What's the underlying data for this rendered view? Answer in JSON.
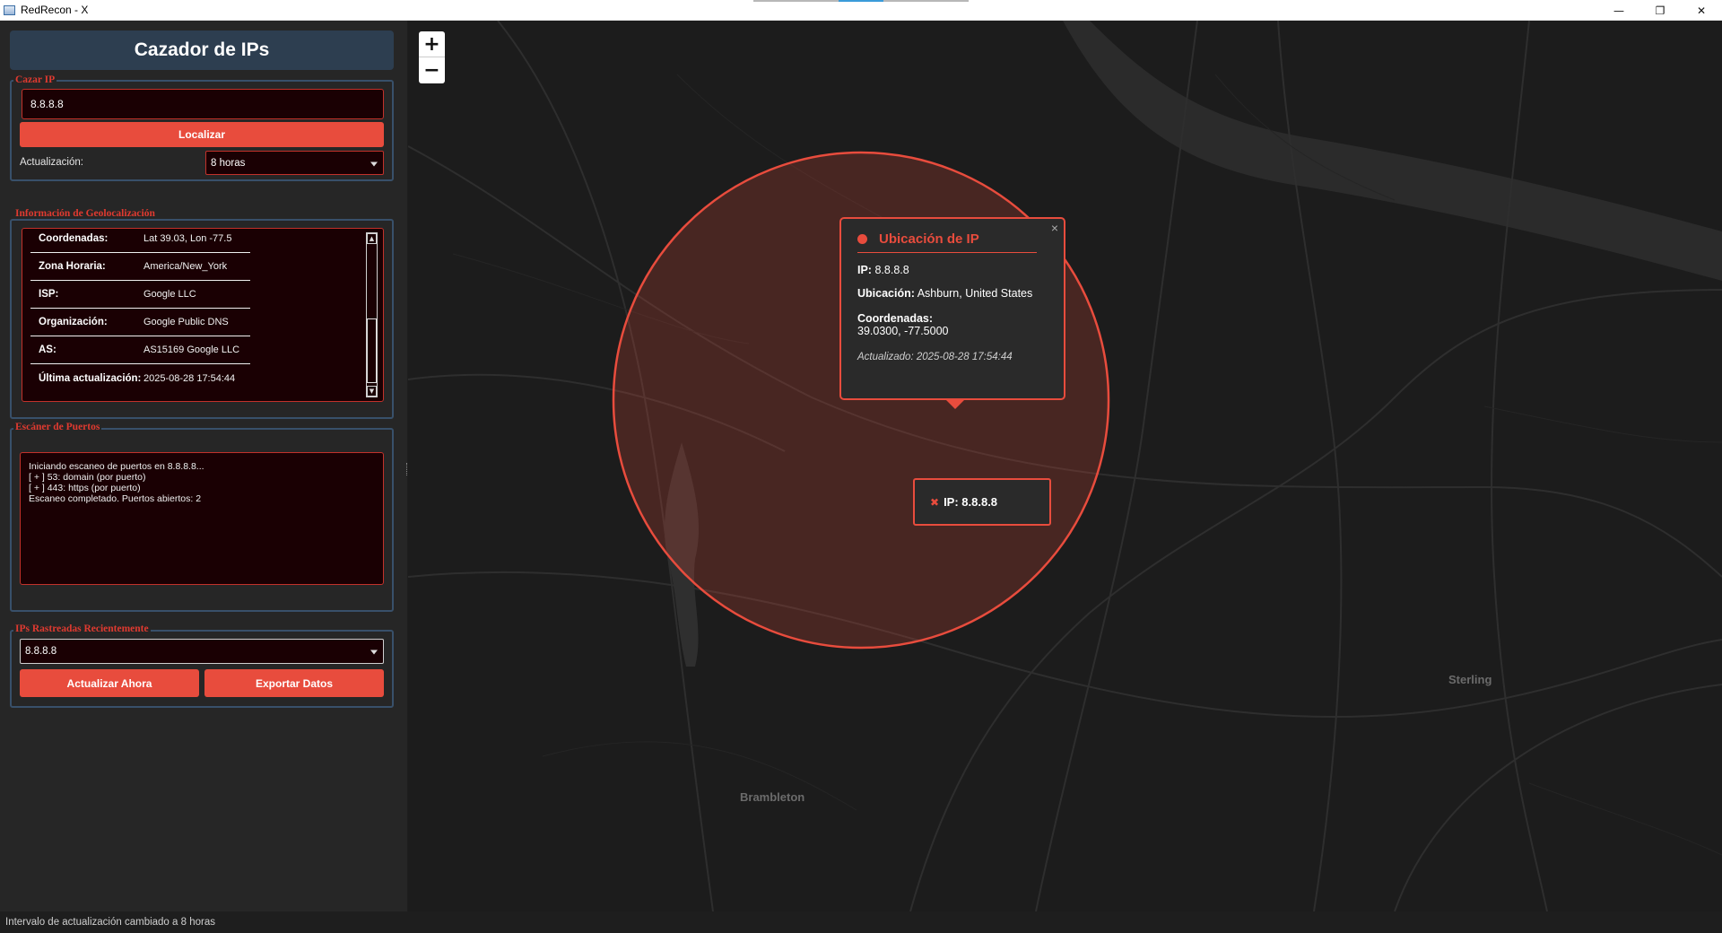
{
  "window": {
    "title": "RedRecon - X",
    "controls": {
      "minimize": "—",
      "restore": "❐",
      "close": "✕"
    }
  },
  "sidebar": {
    "header": "Cazador de IPs",
    "hunt": {
      "label": "Cazar IP",
      "ip_value": "8.8.8.8",
      "locate_button": "Localizar",
      "update_label": "Actualización:",
      "update_value": "8 horas"
    },
    "geo": {
      "label": "Información de Geolocalización",
      "rows": [
        {
          "key": "Coordenadas:",
          "value": "Lat 39.03, Lon -77.5"
        },
        {
          "key": "Zona Horaria:",
          "value": "America/New_York"
        },
        {
          "key": "ISP:",
          "value": "Google LLC"
        },
        {
          "key": "Organización:",
          "value": "Google Public DNS"
        },
        {
          "key": "AS:",
          "value": "AS15169 Google LLC"
        },
        {
          "key": "Última actualización:",
          "value": "2025-08-28 17:54:44"
        }
      ]
    },
    "ports": {
      "label": "Escáner de Puertos",
      "lines": [
        "Iniciando escaneo de puertos en 8.8.8.8...",
        "[ + ] 53: domain (por puerto)",
        "[ + ] 443: https (por puerto)",
        "Escaneo completado. Puertos abiertos: 2"
      ]
    },
    "recent": {
      "label": "IPs Rastreadas Recientemente",
      "selected": "8.8.8.8",
      "refresh_button": "Actualizar Ahora",
      "export_button": "Exportar Datos"
    }
  },
  "map": {
    "zoom_in": "+",
    "zoom_out": "−",
    "places": [
      "Brambleton",
      "Sterling"
    ],
    "popup": {
      "title": "Ubicación de IP",
      "close": "×",
      "ip_label": "IP:",
      "ip_value": "8.8.8.8",
      "location_label": "Ubicación:",
      "location_value": "Ashburn, United States",
      "coords_label": "Coordenadas:",
      "coords_value": "39.0300, -77.5000",
      "updated": "Actualizado: 2025-08-28 17:54:44"
    },
    "marker": {
      "pin": "✖",
      "text": "IP: 8.8.8.8"
    },
    "colors": {
      "accent": "#e84c3d",
      "background": "#1c1c1c"
    }
  },
  "status": "Intervalo de actualización cambiado a 8 horas"
}
